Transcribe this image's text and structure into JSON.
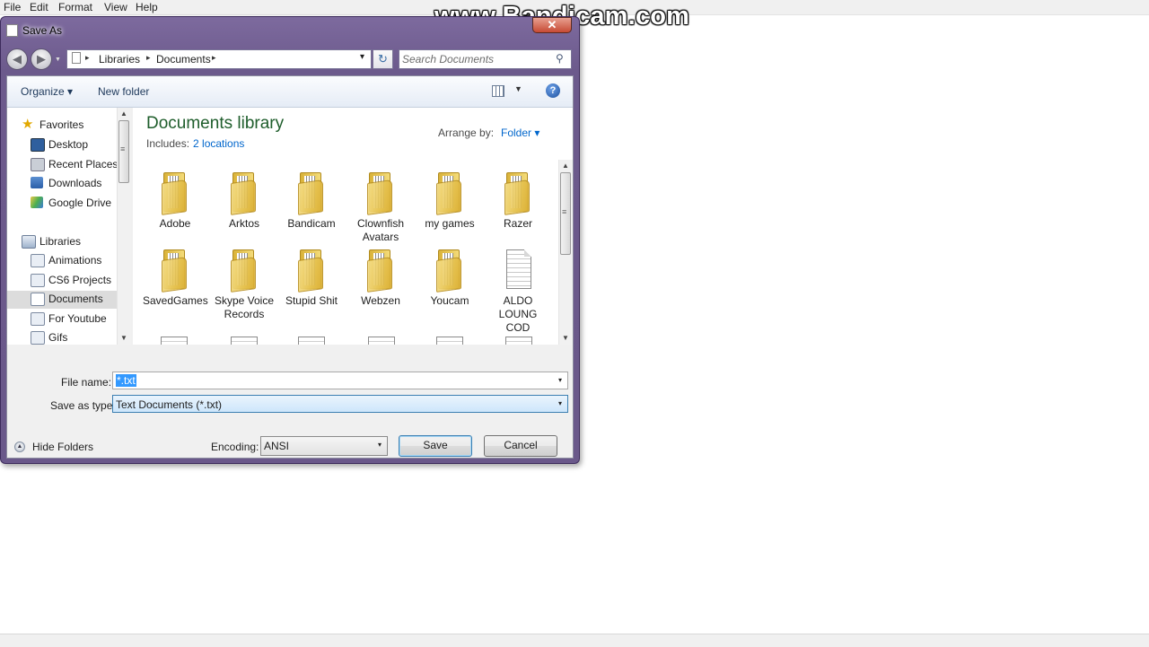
{
  "notepad": {
    "menu": [
      "File",
      "Edit",
      "Format",
      "View",
      "Help"
    ]
  },
  "watermark": "www.Bandicam.com",
  "dialog": {
    "title": "Save As",
    "close_glyph": "✕",
    "address": {
      "crumbs": [
        "Libraries",
        "Documents"
      ],
      "separator": "▸",
      "dropdown_glyph": "▾",
      "refresh_glyph": "↻"
    },
    "search": {
      "placeholder": "Search Documents",
      "value": ""
    },
    "toolbar": {
      "organize": "Organize ▾",
      "new_folder": "New folder",
      "view_arrow": "▼",
      "help_glyph": "?"
    },
    "nav": {
      "favorites_header": "Favorites",
      "favorites": [
        "Desktop",
        "Recent Places",
        "Downloads",
        "Google Drive"
      ],
      "libraries_header": "Libraries",
      "libraries": [
        "Animations",
        "CS6 Projects",
        "Documents",
        "For Youtube",
        "Gifs"
      ],
      "selected": "Documents"
    },
    "library": {
      "title": "Documents library",
      "includes_label": "Includes:",
      "includes_link": "2 locations",
      "arrange_label": "Arrange by:",
      "arrange_value": "Folder ▾"
    },
    "files": [
      {
        "name": "Adobe",
        "kind": "folder-icon"
      },
      {
        "name": "Arktos",
        "kind": "folder-icon"
      },
      {
        "name": "Bandicam",
        "kind": "folder-icon"
      },
      {
        "name": "Clownfish Avatars",
        "kind": "folder-icon"
      },
      {
        "name": "my games",
        "kind": "folder-icon"
      },
      {
        "name": "Razer",
        "kind": "folder-icon"
      },
      {
        "name": "SavedGames",
        "kind": "folder-icon"
      },
      {
        "name": "Skype Voice Records",
        "kind": "folder-icon"
      },
      {
        "name": "Stupid Shit",
        "kind": "folder-icon"
      },
      {
        "name": "Webzen",
        "kind": "folder-icon"
      },
      {
        "name": "Youcam",
        "kind": "folder-icon"
      },
      {
        "name": "ALDO LOUNG COD",
        "kind": "text-document-icon"
      }
    ],
    "form": {
      "file_name_label": "File name:",
      "file_name_value": "*.txt",
      "save_type_label": "Save as type:",
      "save_type_value": "Text Documents (*.txt)",
      "encoding_label": "Encoding:",
      "encoding_value": "ANSI",
      "dropdown_glyph": "▾"
    },
    "buttons": {
      "hide_folders": "Hide Folders",
      "hide_glyph": "▲",
      "save": "Save",
      "cancel": "Cancel"
    },
    "scroll": {
      "up": "▲",
      "down": "▼",
      "grip": "≡"
    }
  }
}
